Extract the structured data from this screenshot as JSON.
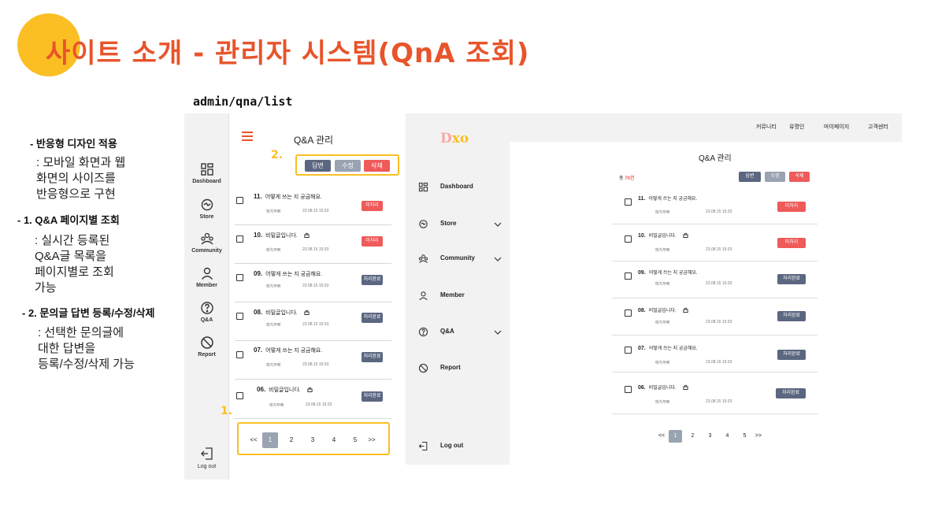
{
  "slide": {
    "title": "사이트 소개 - 관리자 시스템(QnA 조회)",
    "route": "admin/qna/list"
  },
  "description": {
    "responsive_heading": "- 반응형 디자인 적용",
    "responsive_lines": [
      ": 모바일 화면과 웹",
      "화면의 사이즈를",
      "반응형으로 구현"
    ],
    "feature1_heading": "- 1. Q&A 페이지별 조회",
    "feature1_lines": [
      ": 실시간 등록된",
      "Q&A글 목록을",
      "페이지별로 조회",
      "가능"
    ],
    "feature2_heading": "- 2. 문의글 답변 등록/수정/삭제",
    "feature2_lines": [
      ": 선택한 문의글에",
      "대한 답변을",
      "등록/수정/삭제 가능"
    ]
  },
  "annotations": {
    "pagination_marker": "1.",
    "actions_marker": "2."
  },
  "mobile": {
    "sidebar": [
      {
        "label": "Dashboard",
        "icon": "grid-icon"
      },
      {
        "label": "Store",
        "icon": "store-icon"
      },
      {
        "label": "Community",
        "icon": "community-icon"
      },
      {
        "label": "Member",
        "icon": "member-icon"
      },
      {
        "label": "Q&A",
        "icon": "question-icon"
      },
      {
        "label": "Report",
        "icon": "report-icon"
      }
    ],
    "logout_label": "Log out",
    "page_title": "Q&A 관리",
    "actions": {
      "answer": "답변",
      "edit": "수정",
      "delete": "삭제"
    },
    "rows": [
      {
        "no": "11.",
        "title": "어떻게 쓰는 지 궁금해요.",
        "author": "매치무빠",
        "date": "23.08.15 15:33",
        "status": "미처리",
        "status_color": "#ef5a5a",
        "locked": false
      },
      {
        "no": "10.",
        "title": "비밀글입니다.",
        "author": "매치무빠",
        "date": "23.08.15 15:33",
        "status": "미처리",
        "status_color": "#ef5a5a",
        "locked": true
      },
      {
        "no": "09.",
        "title": "어떻게 쓰는 지 궁금해요.",
        "author": "매치무빠",
        "date": "23.08.15 15:33",
        "status": "처리완료",
        "status_color": "#5b6680",
        "locked": false
      },
      {
        "no": "08.",
        "title": "비밀글입니다.",
        "author": "매치무빠",
        "date": "23.08.15 15:33",
        "status": "처리완료",
        "status_color": "#5b6680",
        "locked": true
      },
      {
        "no": "07.",
        "title": "어떻게 쓰는 지 궁금해요.",
        "author": "매치무빠",
        "date": "23.08.15 15:33",
        "status": "처리완료",
        "status_color": "#5b6680",
        "locked": false
      },
      {
        "no": "06.",
        "title": "비밀글입니다.",
        "author": "매치무빠",
        "date": "23.08.15 15:33",
        "status": "처리완료",
        "status_color": "#5b6680",
        "locked": true
      }
    ],
    "pagination": [
      "<<",
      "1",
      "2",
      "3",
      "4",
      "5",
      ">>"
    ],
    "current_page": "1"
  },
  "desktop": {
    "logo_left": "D",
    "logo_right": "xo",
    "top_links": [
      "커뮤니티",
      "유명인",
      "마이페이지",
      "고객센터"
    ],
    "sidebar": [
      {
        "label": "Dashboard",
        "icon": "grid-icon",
        "expandable": false
      },
      {
        "label": "Store",
        "icon": "store-icon",
        "expandable": true
      },
      {
        "label": "Community",
        "icon": "community-icon",
        "expandable": true
      },
      {
        "label": "Member",
        "icon": "member-icon",
        "expandable": false
      },
      {
        "label": "Q&A",
        "icon": "question-icon",
        "expandable": true
      },
      {
        "label": "Report",
        "icon": "report-icon",
        "expandable": false
      }
    ],
    "logout_label": "Log out",
    "page_title": "Q&A 관리",
    "total_prefix": "총",
    "total_count": "70건",
    "actions": {
      "answer": "답변",
      "edit": "수정",
      "delete": "삭제"
    },
    "rows": [
      {
        "no": "11.",
        "title": "어떻게 쓰는 지 궁금해요.",
        "author": "매치무빠",
        "date": "23.08.15 15:33",
        "status": "미처리",
        "status_color": "#ef5a5a",
        "locked": false
      },
      {
        "no": "10.",
        "title": "비밀글입니다.",
        "author": "매치무빠",
        "date": "23.08.15 15:33",
        "status": "미처리",
        "status_color": "#ef5a5a",
        "locked": true
      },
      {
        "no": "09.",
        "title": "어떻게 쓰는 지 궁금해요.",
        "author": "매치무빠",
        "date": "23.08.15 15:33",
        "status": "처리완료",
        "status_color": "#5b6680",
        "locked": false
      },
      {
        "no": "08.",
        "title": "비밀글입니다.",
        "author": "매치무빠",
        "date": "23.08.15 15:33",
        "status": "처리완료",
        "status_color": "#5b6680",
        "locked": true
      },
      {
        "no": "07.",
        "title": "어떻게 쓰는 지 궁금해요.",
        "author": "매치무빠",
        "date": "23.08.15 15:33",
        "status": "처리완료",
        "status_color": "#5b6680",
        "locked": false
      },
      {
        "no": "06.",
        "title": "비밀글입니다.",
        "author": "매치무빠",
        "date": "23.08.15 15:33",
        "status": "처리완료",
        "status_color": "#5b6680",
        "locked": true
      }
    ],
    "pagination": [
      "<<",
      "1",
      "2",
      "3",
      "4",
      "5",
      ">>"
    ],
    "current_page": "1"
  }
}
